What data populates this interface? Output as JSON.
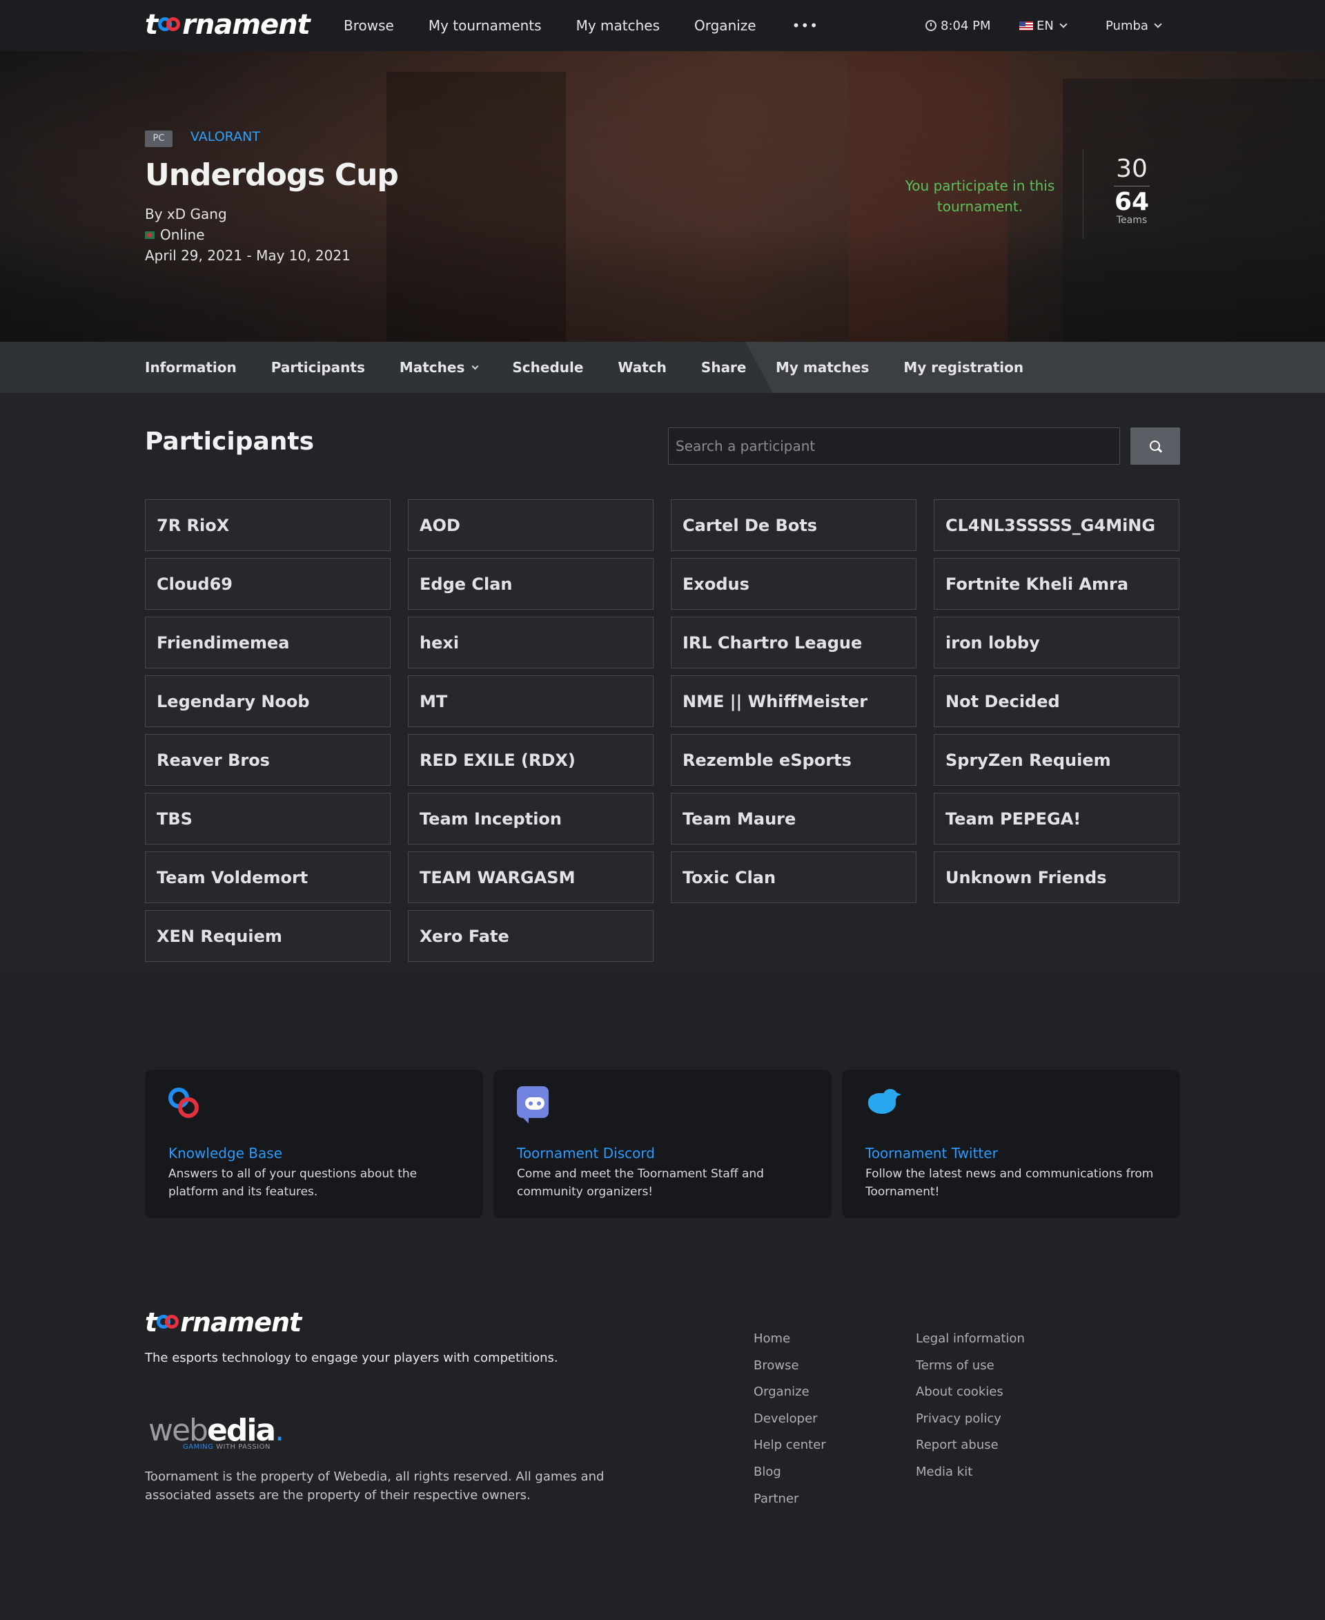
{
  "topbar": {
    "logo_text_left": "t",
    "logo_text_right": "rnament",
    "nav": [
      "Browse",
      "My tournaments",
      "My matches",
      "Organize"
    ],
    "more": "•••",
    "time": "8:04 PM",
    "language": "EN",
    "user": "Pumba"
  },
  "hero": {
    "platform": "PC",
    "game": "VALORANT",
    "title": "Underdogs Cup",
    "organizer": "By xD Gang",
    "location": "Online",
    "dates": "April 29, 2021 - May 10, 2021",
    "participation": "You participate in this tournament.",
    "teams_registered": "30",
    "teams_max": "64",
    "teams_label": "Teams"
  },
  "subnav": {
    "left": [
      "Information",
      "Participants",
      "Matches",
      "Schedule",
      "Watch",
      "Share"
    ],
    "right": [
      "My matches",
      "My registration"
    ]
  },
  "participants": {
    "title": "Participants",
    "search_placeholder": "Search a participant",
    "list": [
      "7R RioX",
      "AOD",
      "Cartel De Bots",
      "CL4NL3SSSSS_G4MiNG",
      "Cloud69",
      "Edge Clan",
      "Exodus",
      "Fortnite Kheli Amra",
      "Friendimemea",
      "hexi",
      "IRL Chartro League",
      "iron lobby",
      "Legendary Noob",
      "MT",
      "NME || WhiffMeister",
      "Not Decided",
      "Reaver Bros",
      "RED EXILE (RDX)",
      "Rezemble eSports",
      "SpryZen Requiem",
      "TBS",
      "Team Inception",
      "Team Maure",
      "Team PEPEGA!",
      "Team Voldemort",
      "TEAM WARGASM",
      "Toxic Clan",
      "Unknown Friends",
      "XEN Requiem",
      "Xero Fate"
    ]
  },
  "help": [
    {
      "title": "Knowledge Base",
      "text": "Answers to all of your questions about the platform and its features."
    },
    {
      "title": "Toornament Discord",
      "text": "Come and meet the Toornament Staff and community organizers!"
    },
    {
      "title": "Toornament Twitter",
      "text": "Follow the latest news and communications from Toornament!"
    }
  ],
  "footer": {
    "tagline": "The esports technology to engage your players with competitions.",
    "webedia_light": "web",
    "webedia_bold": "edia",
    "webedia_sub_a": "GAMING",
    "webedia_sub_b": "WITH PASSION",
    "rights": "Toornament is the property of Webedia, all rights reserved. All games and associated assets are the property of their respective owners.",
    "col1": [
      "Home",
      "Browse",
      "Organize",
      "Developer",
      "Help center",
      "Blog",
      "Partner"
    ],
    "col2": [
      "Legal information",
      "Terms of use",
      "About cookies",
      "Privacy policy",
      "Report abuse",
      "Media kit"
    ]
  },
  "colors": {
    "accent_blue": "#2b9bff",
    "accent_red": "#e1313d",
    "participate_green": "#5cc15a",
    "page_bg": "#222428"
  }
}
